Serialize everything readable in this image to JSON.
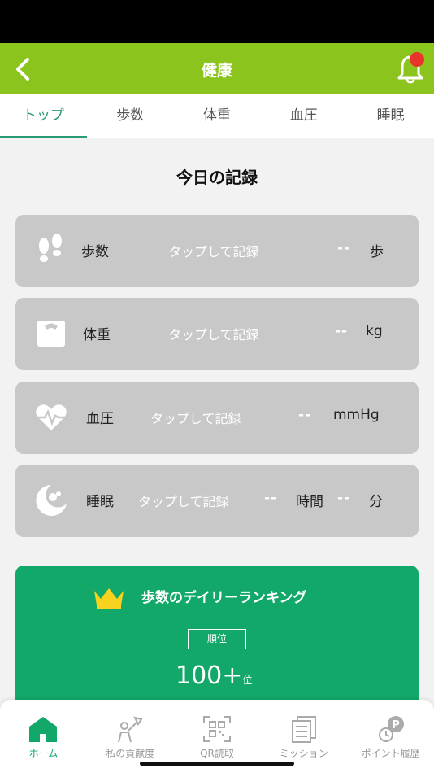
{
  "header": {
    "title": "健康",
    "notification_dot": true
  },
  "colors": {
    "header_bg": "#8bc41c",
    "accent": "#2a9a78",
    "ranking_bg": "#12a86a",
    "card_bg": "#c8c8c8",
    "badge": "#e8342b"
  },
  "tabs": [
    {
      "label": "トップ",
      "active": true
    },
    {
      "label": "歩数",
      "active": false
    },
    {
      "label": "体重",
      "active": false
    },
    {
      "label": "血圧",
      "active": false
    },
    {
      "label": "睡眠",
      "active": false
    }
  ],
  "section_title": "今日の記録",
  "records": {
    "steps": {
      "label": "歩数",
      "hint": "タップして記録",
      "value": "--",
      "unit": "歩",
      "icon": "footprints-icon"
    },
    "weight": {
      "label": "体重",
      "hint": "タップして記録",
      "value": "--",
      "unit": "kg",
      "icon": "scale-icon"
    },
    "pressure": {
      "label": "血圧",
      "hint": "タップして記録",
      "value": "--",
      "unit": "mmHg",
      "icon": "heartbeat-icon"
    },
    "sleep": {
      "label": "睡眠",
      "hint": "タップして記録",
      "hours_value": "--",
      "hours_unit": "時間",
      "minutes_value": "--",
      "minutes_unit": "分",
      "icon": "moon-icon"
    }
  },
  "ranking": {
    "title": "歩数のデイリーランキング",
    "order_label": "順位",
    "rank": "100+",
    "rank_suffix": "位",
    "icon": "crown-icon"
  },
  "bottom_nav": [
    {
      "label": "ホーム",
      "icon": "home-icon",
      "active": true
    },
    {
      "label": "私の貢献度",
      "icon": "contribution-icon",
      "active": false
    },
    {
      "label": "QR読取",
      "icon": "qr-scan-icon",
      "active": false
    },
    {
      "label": "ミッション",
      "icon": "mission-icon",
      "active": false
    },
    {
      "label": "ポイント履歴",
      "icon": "point-history-icon",
      "active": false
    }
  ]
}
